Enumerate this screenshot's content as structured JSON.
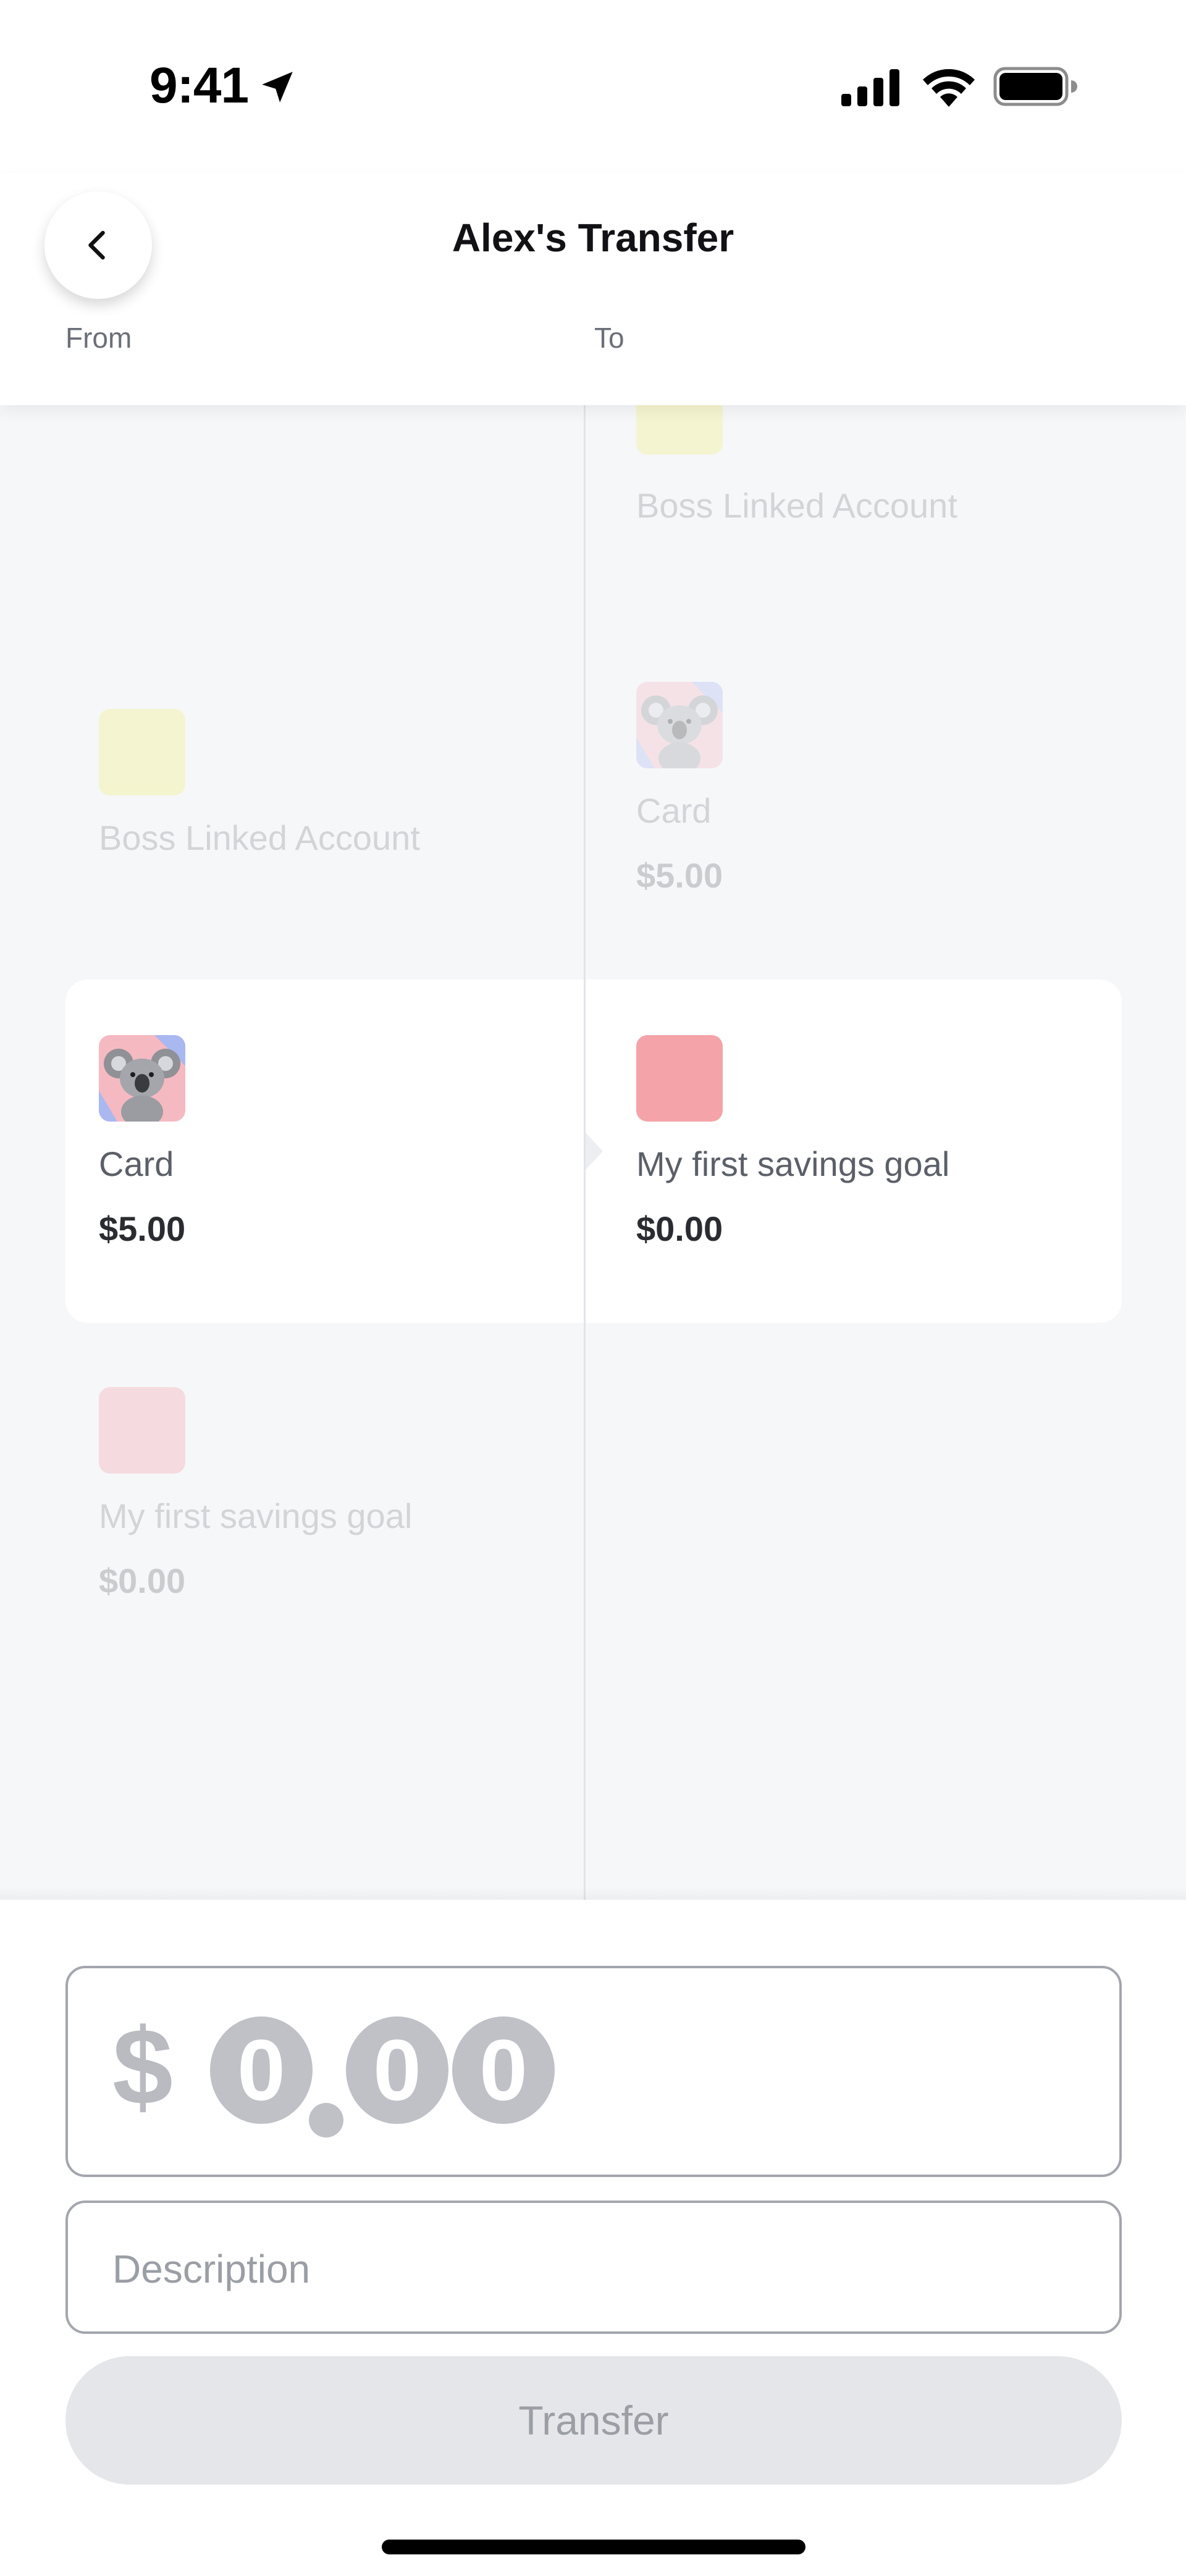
{
  "status_bar": {
    "time": "9:41",
    "icons": [
      "location-arrow-icon",
      "cellular-signal-icon",
      "wifi-icon",
      "battery-icon"
    ]
  },
  "header": {
    "title": "Alex's Transfer",
    "back_icon": "chevron-left-icon",
    "from_label": "From",
    "to_label": "To"
  },
  "from_accounts": [
    {
      "name": "Boss Linked Account",
      "amount": "",
      "color": "#f2f07a",
      "icon": "color-swatch",
      "selected": false
    },
    {
      "name": "Card",
      "amount": "$5.00",
      "color": "#f5b9c2",
      "icon": "koala-card-image",
      "selected": true
    },
    {
      "name": "My first savings goal",
      "amount": "$0.00",
      "color": "#f4a3a8",
      "icon": "color-swatch",
      "selected": false
    }
  ],
  "to_accounts": [
    {
      "name": "Boss Linked Account",
      "amount": "",
      "color": "#f2f07a",
      "icon": "color-swatch",
      "selected": false
    },
    {
      "name": "Card",
      "amount": "$5.00",
      "color": "#f5b9c2",
      "icon": "koala-card-image",
      "selected": false
    },
    {
      "name": "My first savings goal",
      "amount": "$0.00",
      "color": "#f4a3a8",
      "icon": "color-swatch",
      "selected": true
    }
  ],
  "form": {
    "amount_currency": "$",
    "amount_digits": [
      "0",
      "0",
      "0"
    ],
    "description_placeholder": "Description",
    "transfer_label": "Transfer"
  },
  "colors": {
    "picker_background": "#f6f7f9",
    "button_disabled_bg": "#e5e6ea",
    "field_border": "#a3a6ad"
  }
}
